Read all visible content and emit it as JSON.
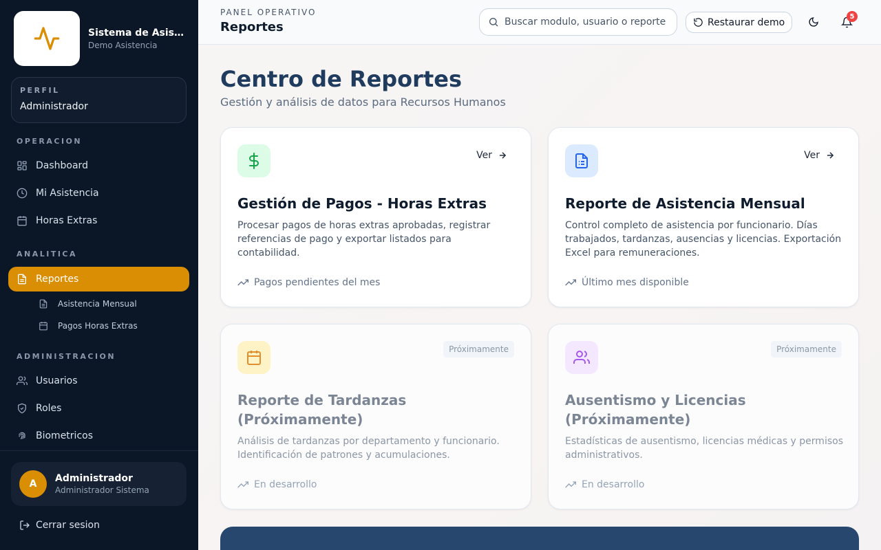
{
  "brand": {
    "title": "Sistema de Asistencia",
    "subtitle": "Demo Asistencia",
    "accent": "#d98e04"
  },
  "profile": {
    "label": "PERFIL",
    "value": "Administrador"
  },
  "nav": {
    "sections": [
      {
        "label": "OPERACION",
        "items": [
          {
            "label": "Dashboard",
            "icon": "dashboard-icon"
          },
          {
            "label": "Mi Asistencia",
            "icon": "clock-icon"
          },
          {
            "label": "Horas Extras",
            "icon": "calendar-icon"
          }
        ]
      },
      {
        "label": "ANALITICA",
        "items": [
          {
            "label": "Reportes",
            "icon": "file-icon",
            "active": true
          }
        ],
        "subitems": [
          {
            "label": "Asistencia Mensual",
            "icon": "file-icon"
          },
          {
            "label": "Pagos Horas Extras",
            "icon": "calendar-icon"
          }
        ]
      },
      {
        "label": "ADMINISTRACION",
        "items": [
          {
            "label": "Usuarios",
            "icon": "users-icon"
          },
          {
            "label": "Roles",
            "icon": "shield-icon"
          },
          {
            "label": "Biometricos",
            "icon": "fingerprint-icon"
          }
        ]
      }
    ]
  },
  "user": {
    "initial": "A",
    "name": "Administrador",
    "role": "Administrador Sistema"
  },
  "logout_label": "Cerrar sesion",
  "header": {
    "kicker": "PANEL OPERATIVO",
    "title": "Reportes",
    "search_placeholder": "Buscar modulo, usuario o reporte",
    "restore_label": "Restaurar demo",
    "notifications_count": "5"
  },
  "page": {
    "title": "Centro de Reportes",
    "subtitle": "Gestión y análisis de datos para Recursos Humanos"
  },
  "cards": [
    {
      "title": "Gestión de Pagos - Horas Extras",
      "description": "Procesar pagos de horas extras aprobadas, registrar referencias de pago y exportar listados para contabilidad.",
      "footer": "Pagos pendientes del mes",
      "link_label": "Ver",
      "icon": "dollar-icon",
      "icon_color": "#16a34a",
      "icon_bg": "#dcfce7"
    },
    {
      "title": "Reporte de Asistencia Mensual",
      "description": "Control completo de asistencia por funcionario. Días trabajados, tardanzas, ausencias y licencias. Exportación Excel para remuneraciones.",
      "footer": "Último mes disponible",
      "link_label": "Ver",
      "icon": "document-icon",
      "icon_color": "#2563eb",
      "icon_bg": "#dbeafe"
    },
    {
      "title": "Reporte de Tardanzas (Próximamente)",
      "description": "Análisis de tardanzas por departamento y funcionario. Identificación de patrones y acumulaciones.",
      "footer": "En desarrollo",
      "badge": "Próximamente",
      "icon": "calendar-icon",
      "icon_color": "#d97706",
      "icon_bg": "#fef3c7"
    },
    {
      "title": "Ausentismo y Licencias (Próximamente)",
      "description": "Estadísticas de ausentismo, licencias médicas y permisos administrativos.",
      "footer": "En desarrollo",
      "badge": "Próximamente",
      "icon": "users-icon",
      "icon_color": "#9333ea",
      "icon_bg": "#f3e8ff"
    }
  ]
}
